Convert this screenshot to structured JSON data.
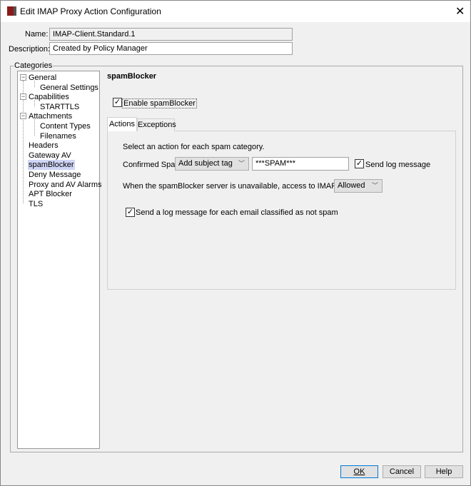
{
  "window": {
    "title": "Edit IMAP Proxy Action Configuration",
    "close_icon": "close-icon",
    "app_icon": "watchguard-icon"
  },
  "form": {
    "name_label": "Name:",
    "name_value": "IMAP-Client.Standard.1",
    "description_label": "Description:",
    "description_value": "Created by Policy Manager"
  },
  "categories": {
    "label": "Categories",
    "selected": "spamBlocker",
    "items": [
      {
        "label": "General"
      },
      {
        "label": "General Settings"
      },
      {
        "label": "Capabilities"
      },
      {
        "label": "STARTTLS"
      },
      {
        "label": "Attachments"
      },
      {
        "label": "Content Types"
      },
      {
        "label": "Filenames"
      },
      {
        "label": "Headers"
      },
      {
        "label": "Gateway AV"
      },
      {
        "label": "spamBlocker"
      },
      {
        "label": "Deny Message"
      },
      {
        "label": "Proxy and AV Alarms"
      },
      {
        "label": "APT Blocker"
      },
      {
        "label": "TLS"
      }
    ]
  },
  "panel": {
    "title": "spamBlocker",
    "enable_label": "Enable spamBlocker",
    "enable_checked": true,
    "tabs": [
      {
        "label": "Actions",
        "active": true
      },
      {
        "label": "Exceptions",
        "active": false
      }
    ],
    "actions": {
      "intro": "Select an action for each spam category.",
      "confirmed_label": "Confirmed Spam:",
      "confirmed_action": "Add subject tag",
      "subject_tag": "***SPAM***",
      "send_log_label": "Send log message",
      "send_log_checked": true,
      "unavailable_label": "When the spamBlocker server is unavailable, access to IMAP email is",
      "unavailable_value": "Allowed",
      "not_spam_log_label": "Send a log message for each email classified as not spam",
      "not_spam_log_checked": true
    }
  },
  "buttons": {
    "ok": "OK",
    "cancel": "Cancel",
    "help": "Help"
  }
}
